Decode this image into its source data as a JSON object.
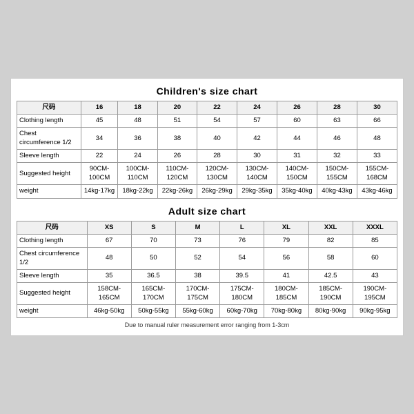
{
  "children_title": "Children's size chart",
  "adult_title": "Adult size chart",
  "footer_note": "Due to manual ruler measurement error ranging from 1-3cm",
  "children": {
    "headers": [
      "尺码",
      "16",
      "18",
      "20",
      "22",
      "24",
      "26",
      "28",
      "30"
    ],
    "rows": [
      {
        "label": "Clothing length",
        "values": [
          "45",
          "48",
          "51",
          "54",
          "57",
          "60",
          "63",
          "66"
        ]
      },
      {
        "label": "Chest circumference 1/2",
        "values": [
          "34",
          "36",
          "38",
          "40",
          "42",
          "44",
          "46",
          "48"
        ]
      },
      {
        "label": "Sleeve length",
        "values": [
          "22",
          "24",
          "26",
          "28",
          "30",
          "31",
          "32",
          "33"
        ]
      },
      {
        "label": "Suggested height",
        "values": [
          "90CM-100CM",
          "100CM-110CM",
          "110CM-120CM",
          "120CM-130CM",
          "130CM-140CM",
          "140CM-150CM",
          "150CM-155CM",
          "155CM-168CM"
        ]
      },
      {
        "label": "weight",
        "values": [
          "14kg-17kg",
          "18kg-22kg",
          "22kg-26kg",
          "26kg-29kg",
          "29kg-35kg",
          "35kg-40kg",
          "40kg-43kg",
          "43kg-46kg"
        ]
      }
    ]
  },
  "adult": {
    "headers": [
      "尺码",
      "XS",
      "S",
      "M",
      "L",
      "XL",
      "XXL",
      "XXXL"
    ],
    "rows": [
      {
        "label": "Clothing length",
        "values": [
          "67",
          "70",
          "73",
          "76",
          "79",
          "82",
          "85"
        ]
      },
      {
        "label": "Chest circumference 1/2",
        "values": [
          "48",
          "50",
          "52",
          "54",
          "56",
          "58",
          "60"
        ]
      },
      {
        "label": "Sleeve length",
        "values": [
          "35",
          "36.5",
          "38",
          "39.5",
          "41",
          "42.5",
          "43"
        ]
      },
      {
        "label": "Suggested height",
        "values": [
          "158CM-165CM",
          "165CM-170CM",
          "170CM-175CM",
          "175CM-180CM",
          "180CM-185CM",
          "185CM-190CM",
          "190CM-195CM"
        ]
      },
      {
        "label": "weight",
        "values": [
          "46kg-50kg",
          "50kg-55kg",
          "55kg-60kg",
          "60kg-70kg",
          "70kg-80kg",
          "80kg-90kg",
          "90kg-95kg"
        ]
      }
    ]
  }
}
